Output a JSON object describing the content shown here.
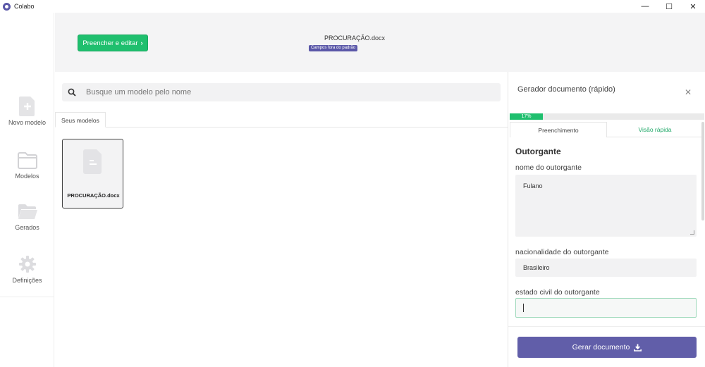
{
  "window": {
    "title": "Colabo",
    "minimize": "—",
    "maximize": "☐",
    "close": "✕"
  },
  "sidebar": {
    "items": [
      {
        "label": "Novo modelo",
        "icon": "new-doc-icon"
      },
      {
        "label": "Modelos",
        "icon": "folder-icon"
      },
      {
        "label": "Gerados",
        "icon": "open-folder-icon"
      },
      {
        "label": "Definições",
        "icon": "gear-icon"
      }
    ]
  },
  "banner": {
    "fill_button": "Preencher e editar",
    "document_name": "PROCURAÇÃO.docx",
    "badge": "Campos fora do padrão"
  },
  "search": {
    "placeholder": "Busque um modelo pelo nome"
  },
  "tabs": {
    "models": "Seus modelos"
  },
  "models": [
    {
      "name": "PROCURAÇÃO.docx"
    }
  ],
  "panel": {
    "title": "Gerador documento (rápido)",
    "close": "✕",
    "progress_label": "17%",
    "progress_value": 17,
    "tab_fill": "Preenchimento",
    "tab_preview": "Visão rápida",
    "section": "Outorgante",
    "fields": [
      {
        "label": "nome do outorgante",
        "value": "Fulano"
      },
      {
        "label": "nacionalidade do outorgante",
        "value": "Brasileiro"
      },
      {
        "label": "estado civil do outorgante",
        "value": ""
      }
    ],
    "generate_button": "Gerar documento"
  },
  "colors": {
    "accent_green": "#1fbf6e",
    "accent_purple": "#615ea9"
  }
}
